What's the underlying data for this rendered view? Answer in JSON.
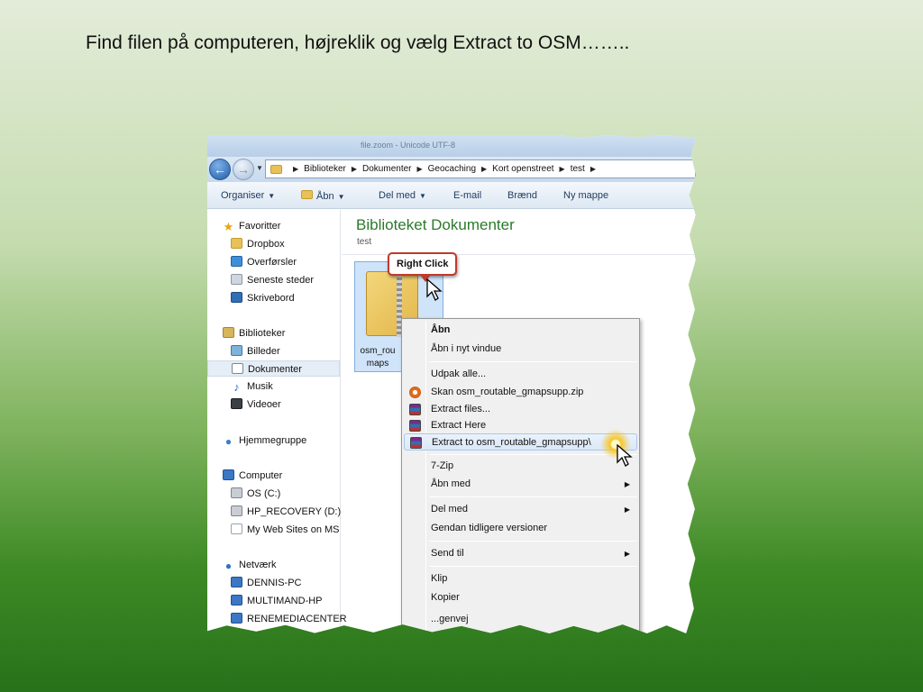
{
  "slide": {
    "title": "Find filen på computeren, højreklik og vælg Extract to OSM…….."
  },
  "explorer": {
    "titlebar_text": "file.zoom - Unicode UTF-8",
    "breadcrumbs": [
      "Biblioteker",
      "Dokumenter",
      "Geocaching",
      "Kort openstreet",
      "test"
    ],
    "toolbar": {
      "organize": "Organiser",
      "open": "Åbn",
      "share": "Del med",
      "email": "E-mail",
      "burn": "Brænd",
      "new_folder": "Ny mappe"
    },
    "nav": {
      "favorites": "Favoritter",
      "dropbox": "Dropbox",
      "downloads": "Overførsler",
      "recent": "Seneste steder",
      "desktop": "Skrivebord",
      "libraries": "Biblioteker",
      "pictures": "Billeder",
      "documents": "Dokumenter",
      "music": "Musik",
      "videos": "Videoer",
      "homegroup": "Hjemmegruppe",
      "computer": "Computer",
      "drive_c": "OS (C:)",
      "drive_d": "HP_RECOVERY (D:)",
      "web_sites": "My Web Sites on MS",
      "network": "Netværk",
      "pc1": "DENNIS-PC",
      "pc2": "MULTIMAND-HP",
      "pc3": "RENEMEDIACENTER"
    },
    "content": {
      "title": "Biblioteket Dokumenter",
      "subtitle": "test",
      "file_label_1": "osm_rou",
      "file_label_2": "maps"
    },
    "callout": "Right Click"
  },
  "context_menu": {
    "open": "Åbn",
    "open_new_window": "Åbn i nyt vindue",
    "extract_all": "Udpak alle...",
    "scan": "Skan osm_routable_gmapsupp.zip",
    "extract_files": "Extract files...",
    "extract_here": "Extract Here",
    "extract_to": "Extract to osm_routable_gmapsupp\\",
    "seven_zip": "7-Zip",
    "open_with": "Åbn med",
    "share_with": "Del med",
    "restore": "Gendan tidligere versioner",
    "send_to": "Send til",
    "cut": "Klip",
    "copy": "Kopier",
    "partial": "...genvej"
  }
}
